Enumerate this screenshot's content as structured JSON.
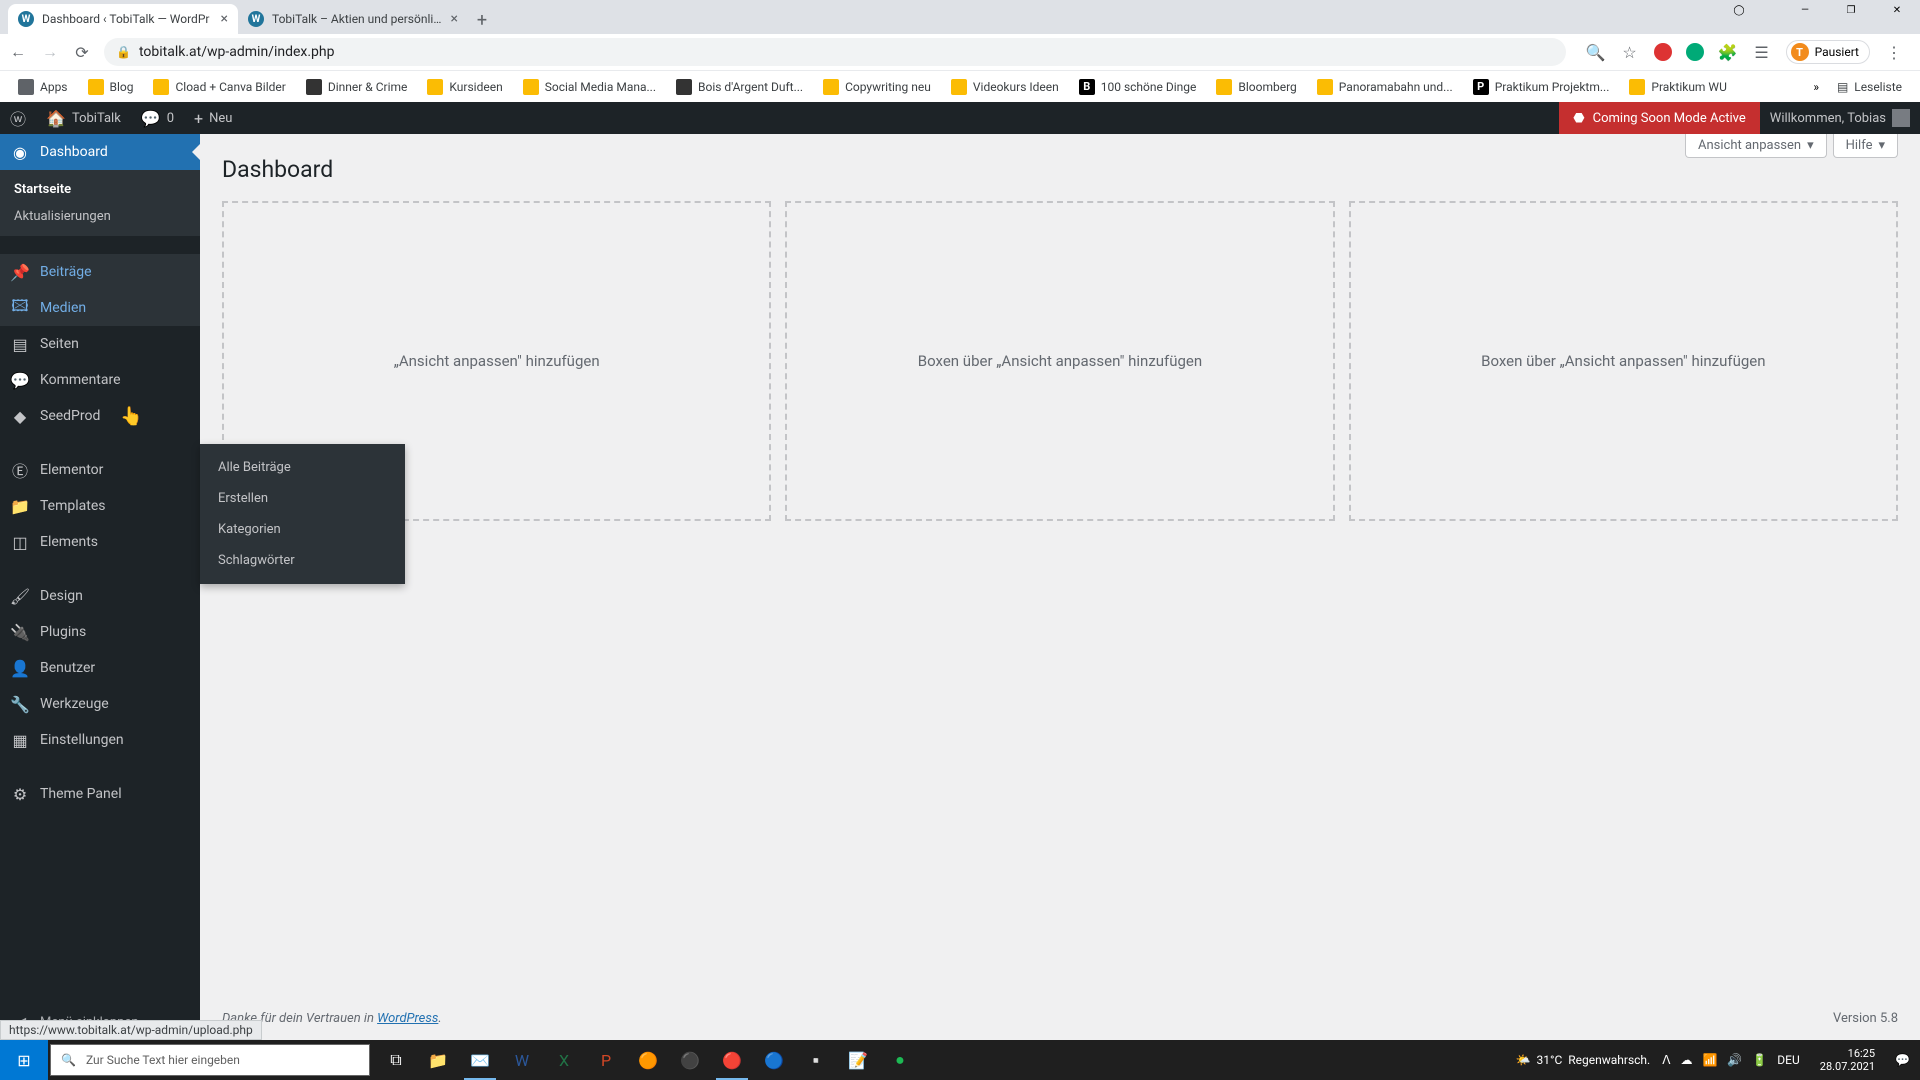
{
  "browser": {
    "tabs": [
      {
        "title": "Dashboard ‹ TobiTalk — WordPr"
      },
      {
        "title": "TobiTalk – Aktien und persönlich"
      }
    ],
    "url": "tobitalk.at/wp-admin/index.php",
    "profile_label": "Pausiert",
    "profile_initial": "T",
    "bookmarks": [
      "Apps",
      "Blog",
      "Cload + Canva Bilder",
      "Dinner & Crime",
      "Kursideen",
      "Social Media Mana...",
      "Bois d'Argent Duft...",
      "Copywriting neu",
      "Videokurs Ideen",
      "100 schöne Dinge",
      "Bloomberg",
      "Panoramabahn und...",
      "Praktikum Projektm...",
      "Praktikum WU"
    ],
    "reading_list": "Leseliste"
  },
  "adminbar": {
    "site": "TobiTalk",
    "comments": "0",
    "new": "Neu",
    "coming_soon": "Coming Soon Mode Active",
    "welcome": "Willkommen, Tobias"
  },
  "sidebar": {
    "items": [
      {
        "icon": "◈",
        "label": "Dashboard",
        "current": true
      },
      {
        "label": "Startseite",
        "sub": true,
        "current": true
      },
      {
        "label": "Aktualisierungen",
        "sub": true
      },
      {
        "sep": true
      },
      {
        "icon": "📌",
        "label": "Beiträge",
        "hover": true
      },
      {
        "icon": "🖼",
        "label": "Medien",
        "hover": true
      },
      {
        "icon": "▤",
        "label": "Seiten"
      },
      {
        "icon": "💬",
        "label": "Kommentare"
      },
      {
        "icon": "◆",
        "label": "SeedProd"
      },
      {
        "sep": true
      },
      {
        "icon": "Ⓔ",
        "label": "Elementor"
      },
      {
        "icon": "📁",
        "label": "Templates"
      },
      {
        "icon": "◫",
        "label": "Elements"
      },
      {
        "sep": true
      },
      {
        "icon": "🖌",
        "label": "Design"
      },
      {
        "icon": "🔌",
        "label": "Plugins"
      },
      {
        "icon": "👤",
        "label": "Benutzer"
      },
      {
        "icon": "🔧",
        "label": "Werkzeuge"
      },
      {
        "icon": "⚙",
        "label": "Einstellungen"
      },
      {
        "sep": true
      },
      {
        "icon": "⚙",
        "label": "Theme Panel"
      }
    ],
    "collapse": "Menü einklappen",
    "flyout": [
      "Alle Beiträge",
      "Erstellen",
      "Kategorien",
      "Schlagwörter"
    ]
  },
  "body": {
    "title": "Dashboard",
    "screen_options": "Ansicht anpassen",
    "help": "Hilfe",
    "widget_placeholder": "Boxen über „Ansicht anpassen\" hinzufügen",
    "widget_placeholder_cut": "„Ansicht anpassen\" hinzufügen"
  },
  "footer": {
    "thanks_pre": "Danke für dein Vertrauen in ",
    "wordpress_link": "WordPress",
    "version": "Version 5.8"
  },
  "status_url": "https://www.tobitalk.at/wp-admin/upload.php",
  "taskbar": {
    "search_placeholder": "Zur Suche Text hier eingeben",
    "weather_temp": "31°C",
    "weather_text": "Regenwahrsch.",
    "lang": "DEU",
    "time": "16:25",
    "date": "28.07.2021"
  }
}
